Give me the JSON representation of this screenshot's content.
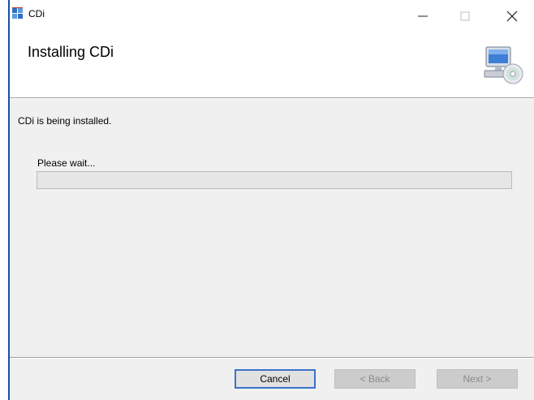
{
  "window": {
    "title": "CDi",
    "controls": {
      "minimize": "—",
      "maximize": "☐",
      "close": "✕"
    }
  },
  "header": {
    "title": "Installing CDi",
    "icon": "computer-cd-icon"
  },
  "body": {
    "status": "CDi is being installed.",
    "wait_label": "Please wait...",
    "progress_percent": 0
  },
  "buttons": {
    "cancel": "Cancel",
    "back": "< Back",
    "next": "Next >"
  },
  "colors": {
    "accent": "#3a72c9",
    "progress_fill": "#06b025",
    "dialog_bg": "#f0f0f0"
  }
}
